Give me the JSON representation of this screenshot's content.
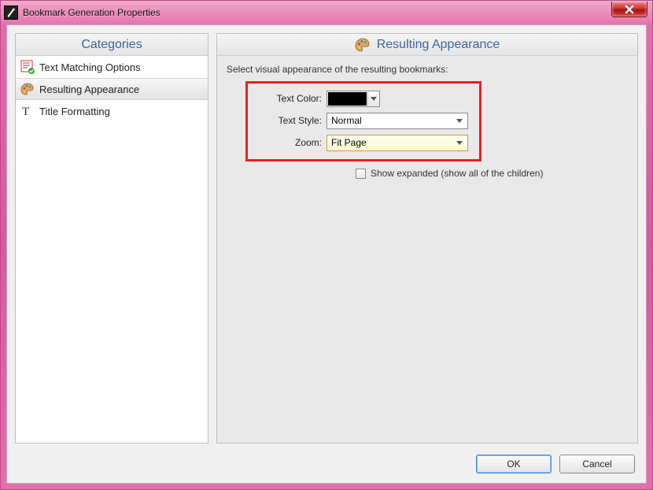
{
  "window": {
    "title": "Bookmark Generation Properties"
  },
  "categories": {
    "header": "Categories",
    "items": [
      {
        "label": "Text Matching Options"
      },
      {
        "label": "Resulting Appearance"
      },
      {
        "label": "Title Formatting"
      }
    ]
  },
  "result": {
    "header": "Resulting Appearance",
    "instruction": "Select visual appearance of the resulting bookmarks:",
    "labels": {
      "text_color": "Text Color:",
      "text_style": "Text Style:",
      "zoom": "Zoom:"
    },
    "values": {
      "text_color": "#000000",
      "text_style": "Normal",
      "zoom": "Fit Page"
    },
    "show_expanded_label": "Show expanded (show all of the children)",
    "show_expanded_checked": false
  },
  "buttons": {
    "ok": "OK",
    "cancel": "Cancel"
  }
}
